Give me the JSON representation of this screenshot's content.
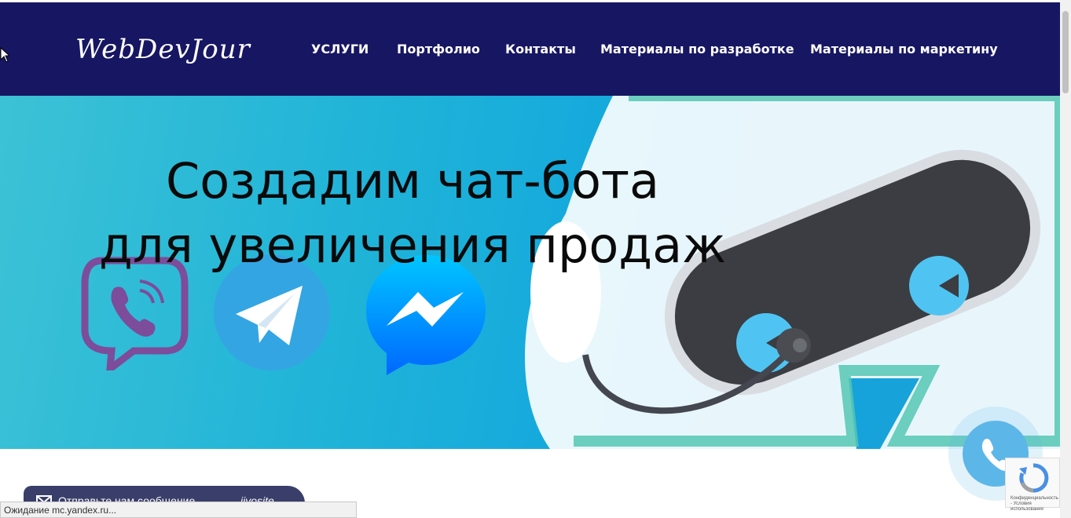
{
  "header": {
    "logo": "WebDevJour",
    "nav": [
      {
        "label": "УСЛУГИ"
      },
      {
        "label": "Портфолио"
      },
      {
        "label": "Контакты"
      },
      {
        "label": "Материалы по разработке"
      },
      {
        "label": "Материалы по маркетину"
      }
    ]
  },
  "hero": {
    "title_line1": "Создадим чат-бота",
    "title_line2": "для увеличения продаж"
  },
  "chat_widget": {
    "text": "Отправьте нам сообщение",
    "brand": "jivosite"
  },
  "statusbar": {
    "text": "Ожидание mc.yandex.ru..."
  },
  "recaptcha": {
    "text": "Конфиденциальность - Условия использования"
  },
  "colors": {
    "header_bg": "#171663",
    "hero_bg": "#12a7de",
    "call_button": "#5db6e8"
  }
}
